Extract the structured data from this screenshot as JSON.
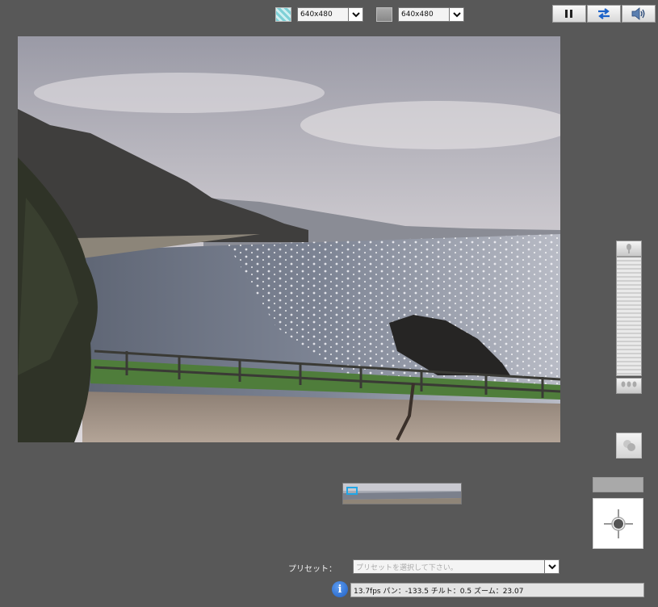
{
  "top_bar": {
    "resolution_color_icon": "color-mode-icon",
    "resolution_color_value": "640x480",
    "resolution_mono_icon": "mono-mode-icon",
    "resolution_mono_value": "640x480"
  },
  "toolbar": {
    "pause_icon": "pause-icon",
    "switch_icon": "swap-arrows-icon",
    "audio_icon": "speaker-icon"
  },
  "camera": {
    "scene": "live camera image of a coastal bay"
  },
  "preset": {
    "label": "プリセット：",
    "placeholder": "プリセットを選択して下さい。"
  },
  "status": {
    "text": "13.7fps パン：-133.5 チルト：0.5 ズーム：23.07"
  },
  "colors": {
    "background": "#585858",
    "status_bg": "#e4e4e4",
    "info_blue": "#1f5fc4"
  }
}
